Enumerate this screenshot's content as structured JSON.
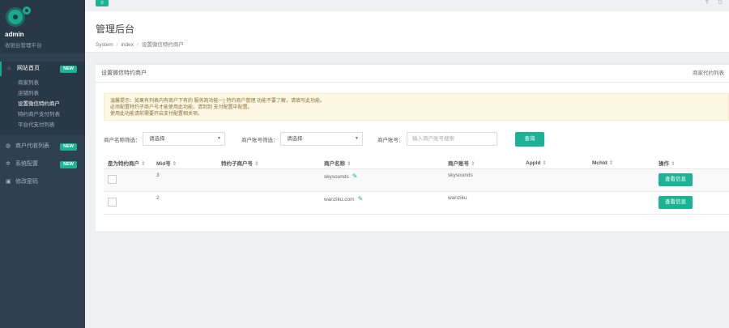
{
  "brand": {
    "name": "admin",
    "subtitle": "收银台管理平台"
  },
  "sidebar": {
    "items": [
      {
        "label": "网站首页",
        "badge": "NEW",
        "icon": "home-icon"
      },
      {
        "label": "商户代收列表",
        "badge": "NEW",
        "icon": "globe-icon"
      },
      {
        "label": "系统配置",
        "badge": "NEW",
        "icon": "gear-icon"
      },
      {
        "label": "修改密码",
        "badge": "",
        "icon": "lock-icon"
      }
    ],
    "subitems": [
      "商家列表",
      "店铺列表",
      "设置微信特约商户",
      "特约商户支付列表",
      "平台代支付列表"
    ]
  },
  "topbar": {
    "menu_icon": "≡",
    "help_icon": "?",
    "exit_icon": "⎋"
  },
  "page": {
    "title": "管理后台",
    "breadcrumb": [
      "System",
      "index",
      "设置微信特约商户"
    ]
  },
  "panel": {
    "title": "设置微信特约商户",
    "right_link": "商家代约列表",
    "alert": [
      "温馨提示：如果有列表内有商户下有的 服务商功能一) 特约商户管理 功能不要了解，请填写此功能。",
      "必须配置特约子商户号才能使用此功能，请到到 支付配置中配置。",
      "使用此功能请前需要开启支付配置相关项。"
    ]
  },
  "filters": {
    "status_label": "商户名称筛选：",
    "status_value": "请选择",
    "type_label": "商户账号筛选：",
    "type_value": "请选择",
    "account_label": "商户账号：",
    "account_placeholder": "输入商户账号搜索",
    "query_label": "查询"
  },
  "table": {
    "headers": [
      "是为特约商户",
      "Mid号",
      "特约子商户号",
      "商户名称",
      "商户账号",
      "AppId",
      "MchId",
      "操作"
    ],
    "rows": [
      {
        "mid": "3",
        "sub_mch": "",
        "name": "skysounds",
        "account": "skysounds",
        "appid": "",
        "mchid": "",
        "action": "查看信息"
      },
      {
        "mid": "2",
        "sub_mch": "",
        "name": "wanziku.com",
        "account": "wanziku",
        "appid": "",
        "mchid": "",
        "action": "查看信息"
      }
    ]
  },
  "colors": {
    "accent": "#1ab394",
    "sidebar": "#2f4050",
    "alert_bg": "#fcf8e3"
  }
}
